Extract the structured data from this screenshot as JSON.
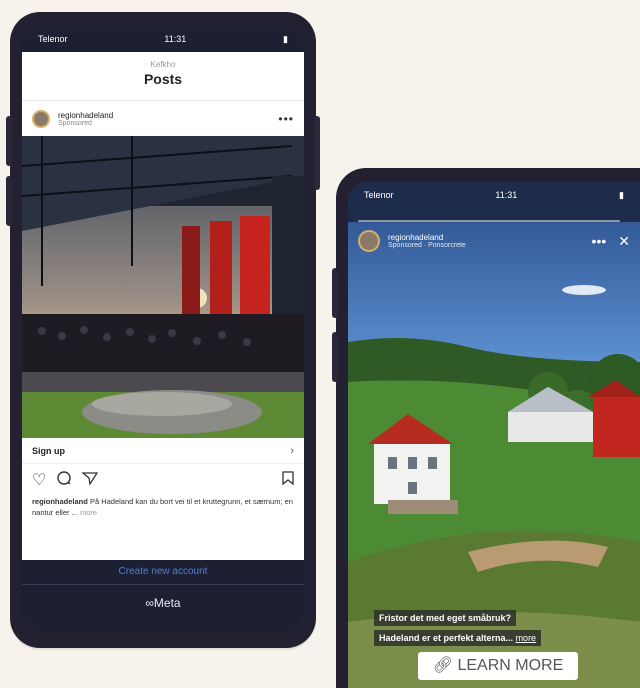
{
  "phone1": {
    "status": {
      "carrier": "Telenor",
      "time": "11:31",
      "battery": ""
    },
    "header": {
      "account": "Kefkho",
      "title": "Posts"
    },
    "post": {
      "username": "regionhadeland",
      "sponsored": "Sponsored",
      "more": "•••",
      "signup": "Sign up",
      "signup_chevron": "›",
      "icons": {
        "like": "heart-icon",
        "comment": "comment-icon",
        "share": "send-icon",
        "save": "bookmark-icon"
      },
      "caption_user": "regionhadeland",
      "caption_text": "På Hadeland kan du bort vei til et kruttegrunn, et særnum; en nantur eller ...",
      "caption_more": "more"
    },
    "create_account": "Create new account",
    "meta_logo": "∞Meta"
  },
  "phone2": {
    "status": {
      "carrier": "Telenor",
      "time": "11:31",
      "battery": ""
    },
    "story": {
      "username": "regionhadeland",
      "sponsored": "Sponsored · Ponsorcrete",
      "more": "•••",
      "close": "✕",
      "line1": "Fristor det med eget småbruk?",
      "line2": "Hadeland er et perfekt alterna...",
      "line2_more": "more",
      "cta": "LEARN MORE",
      "cta_icon": "link-icon"
    }
  }
}
